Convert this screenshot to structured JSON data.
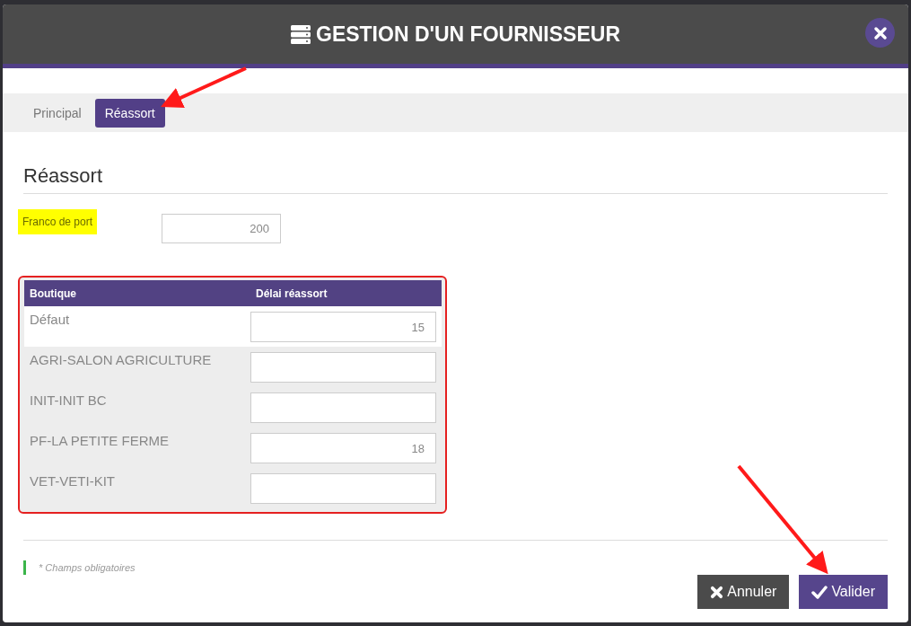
{
  "dialog": {
    "title": "GESTION D'UN FOURNISSEUR"
  },
  "tabs": [
    {
      "label": "Principal",
      "selected": false
    },
    {
      "label": "Réassort",
      "selected": true
    }
  ],
  "section": {
    "heading": "Réassort"
  },
  "field": {
    "label": "Franco de port",
    "highlighted": true,
    "value": "200"
  },
  "table": {
    "columns": [
      "Boutique",
      "Délai réassort"
    ],
    "rows": [
      {
        "shop": "Défaut",
        "delay": "15"
      },
      {
        "shop": "AGRI-SALON AGRICULTURE"
      },
      {
        "shop": "INIT-INIT BC"
      },
      {
        "shop": "PF-LA PETITE FERME",
        "delay": "18"
      },
      {
        "shop": "VET-VETI-KIT"
      }
    ]
  },
  "footer_note": "* Champs obligatoires",
  "buttons": [
    {
      "label": "Annuler",
      "kind": "cancel"
    },
    {
      "label": "Valider",
      "kind": "confirm"
    }
  ]
}
